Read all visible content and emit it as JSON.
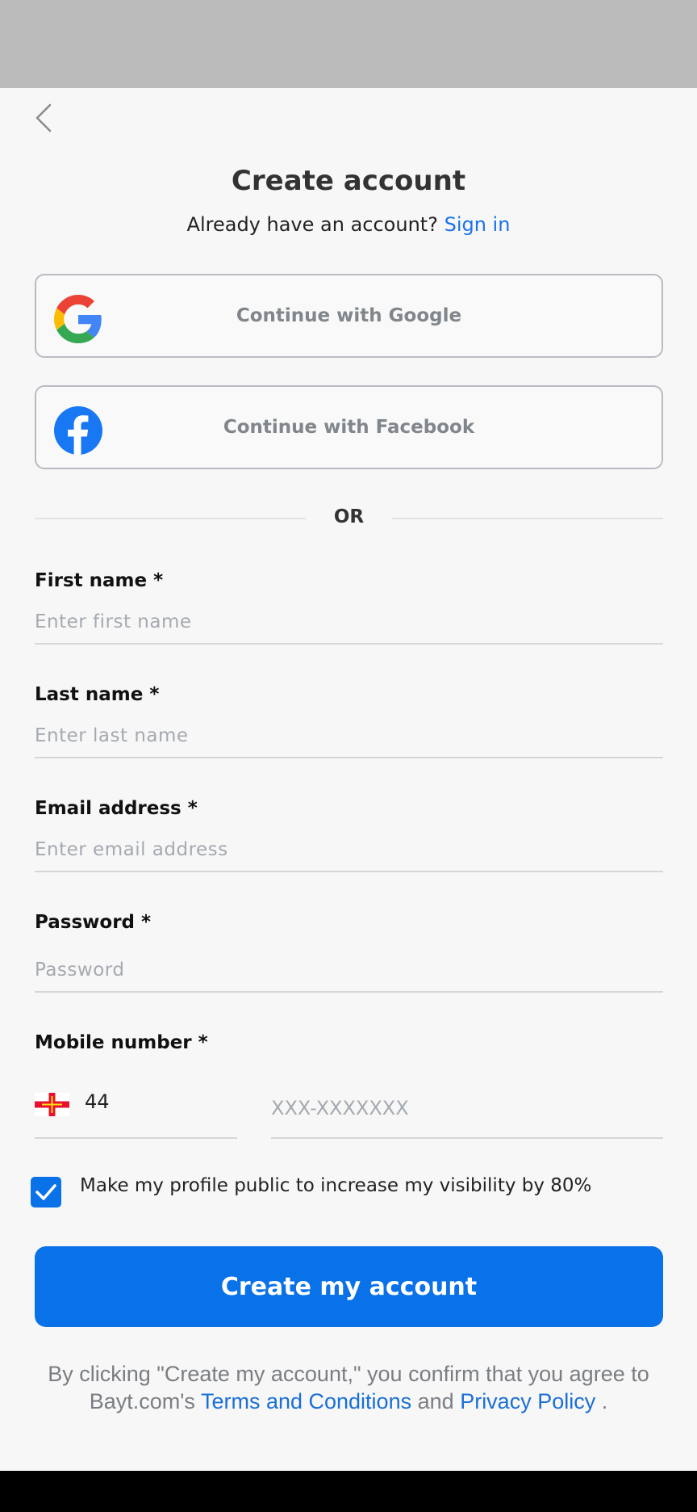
{
  "header": {
    "back_icon": "chevron-left-icon",
    "title": "Create account",
    "subtitle_text": "Already have an account?",
    "signin_link": "Sign in"
  },
  "social": {
    "google": {
      "label": "Continue with Google",
      "icon": "google-icon"
    },
    "facebook": {
      "label": "Continue with Facebook",
      "icon": "facebook-icon"
    }
  },
  "divider": {
    "label": "OR"
  },
  "form": {
    "first_name": {
      "label": "First name *",
      "placeholder": "Enter first name",
      "value": ""
    },
    "last_name": {
      "label": "Last name *",
      "placeholder": "Enter last name",
      "value": ""
    },
    "email": {
      "label": "Email address *",
      "placeholder": "Enter email address",
      "value": ""
    },
    "password": {
      "label": "Password *",
      "placeholder": "Password",
      "value": ""
    },
    "mobile": {
      "label": "Mobile number *",
      "country_code": "44",
      "flag_icon": "guernsey-flag-icon",
      "placeholder": "XXX-XXXXXXX",
      "value": ""
    },
    "public_profile": {
      "checked": true,
      "label": "Make my profile public to increase my visibility by 80%"
    }
  },
  "submit": {
    "label": "Create my account"
  },
  "disclaimer": {
    "text_1": "By clicking \"Create my account,\" you confirm that you agree to Bayt.com's",
    "terms_link": "Terms and Conditions",
    "text_2": "and",
    "privacy_link": "Privacy Policy",
    "text_3": "."
  },
  "colors": {
    "accent": "#0a72e8",
    "link": "#1a73e8",
    "status_bar": "#bababa",
    "background": "#f7f7f7"
  }
}
